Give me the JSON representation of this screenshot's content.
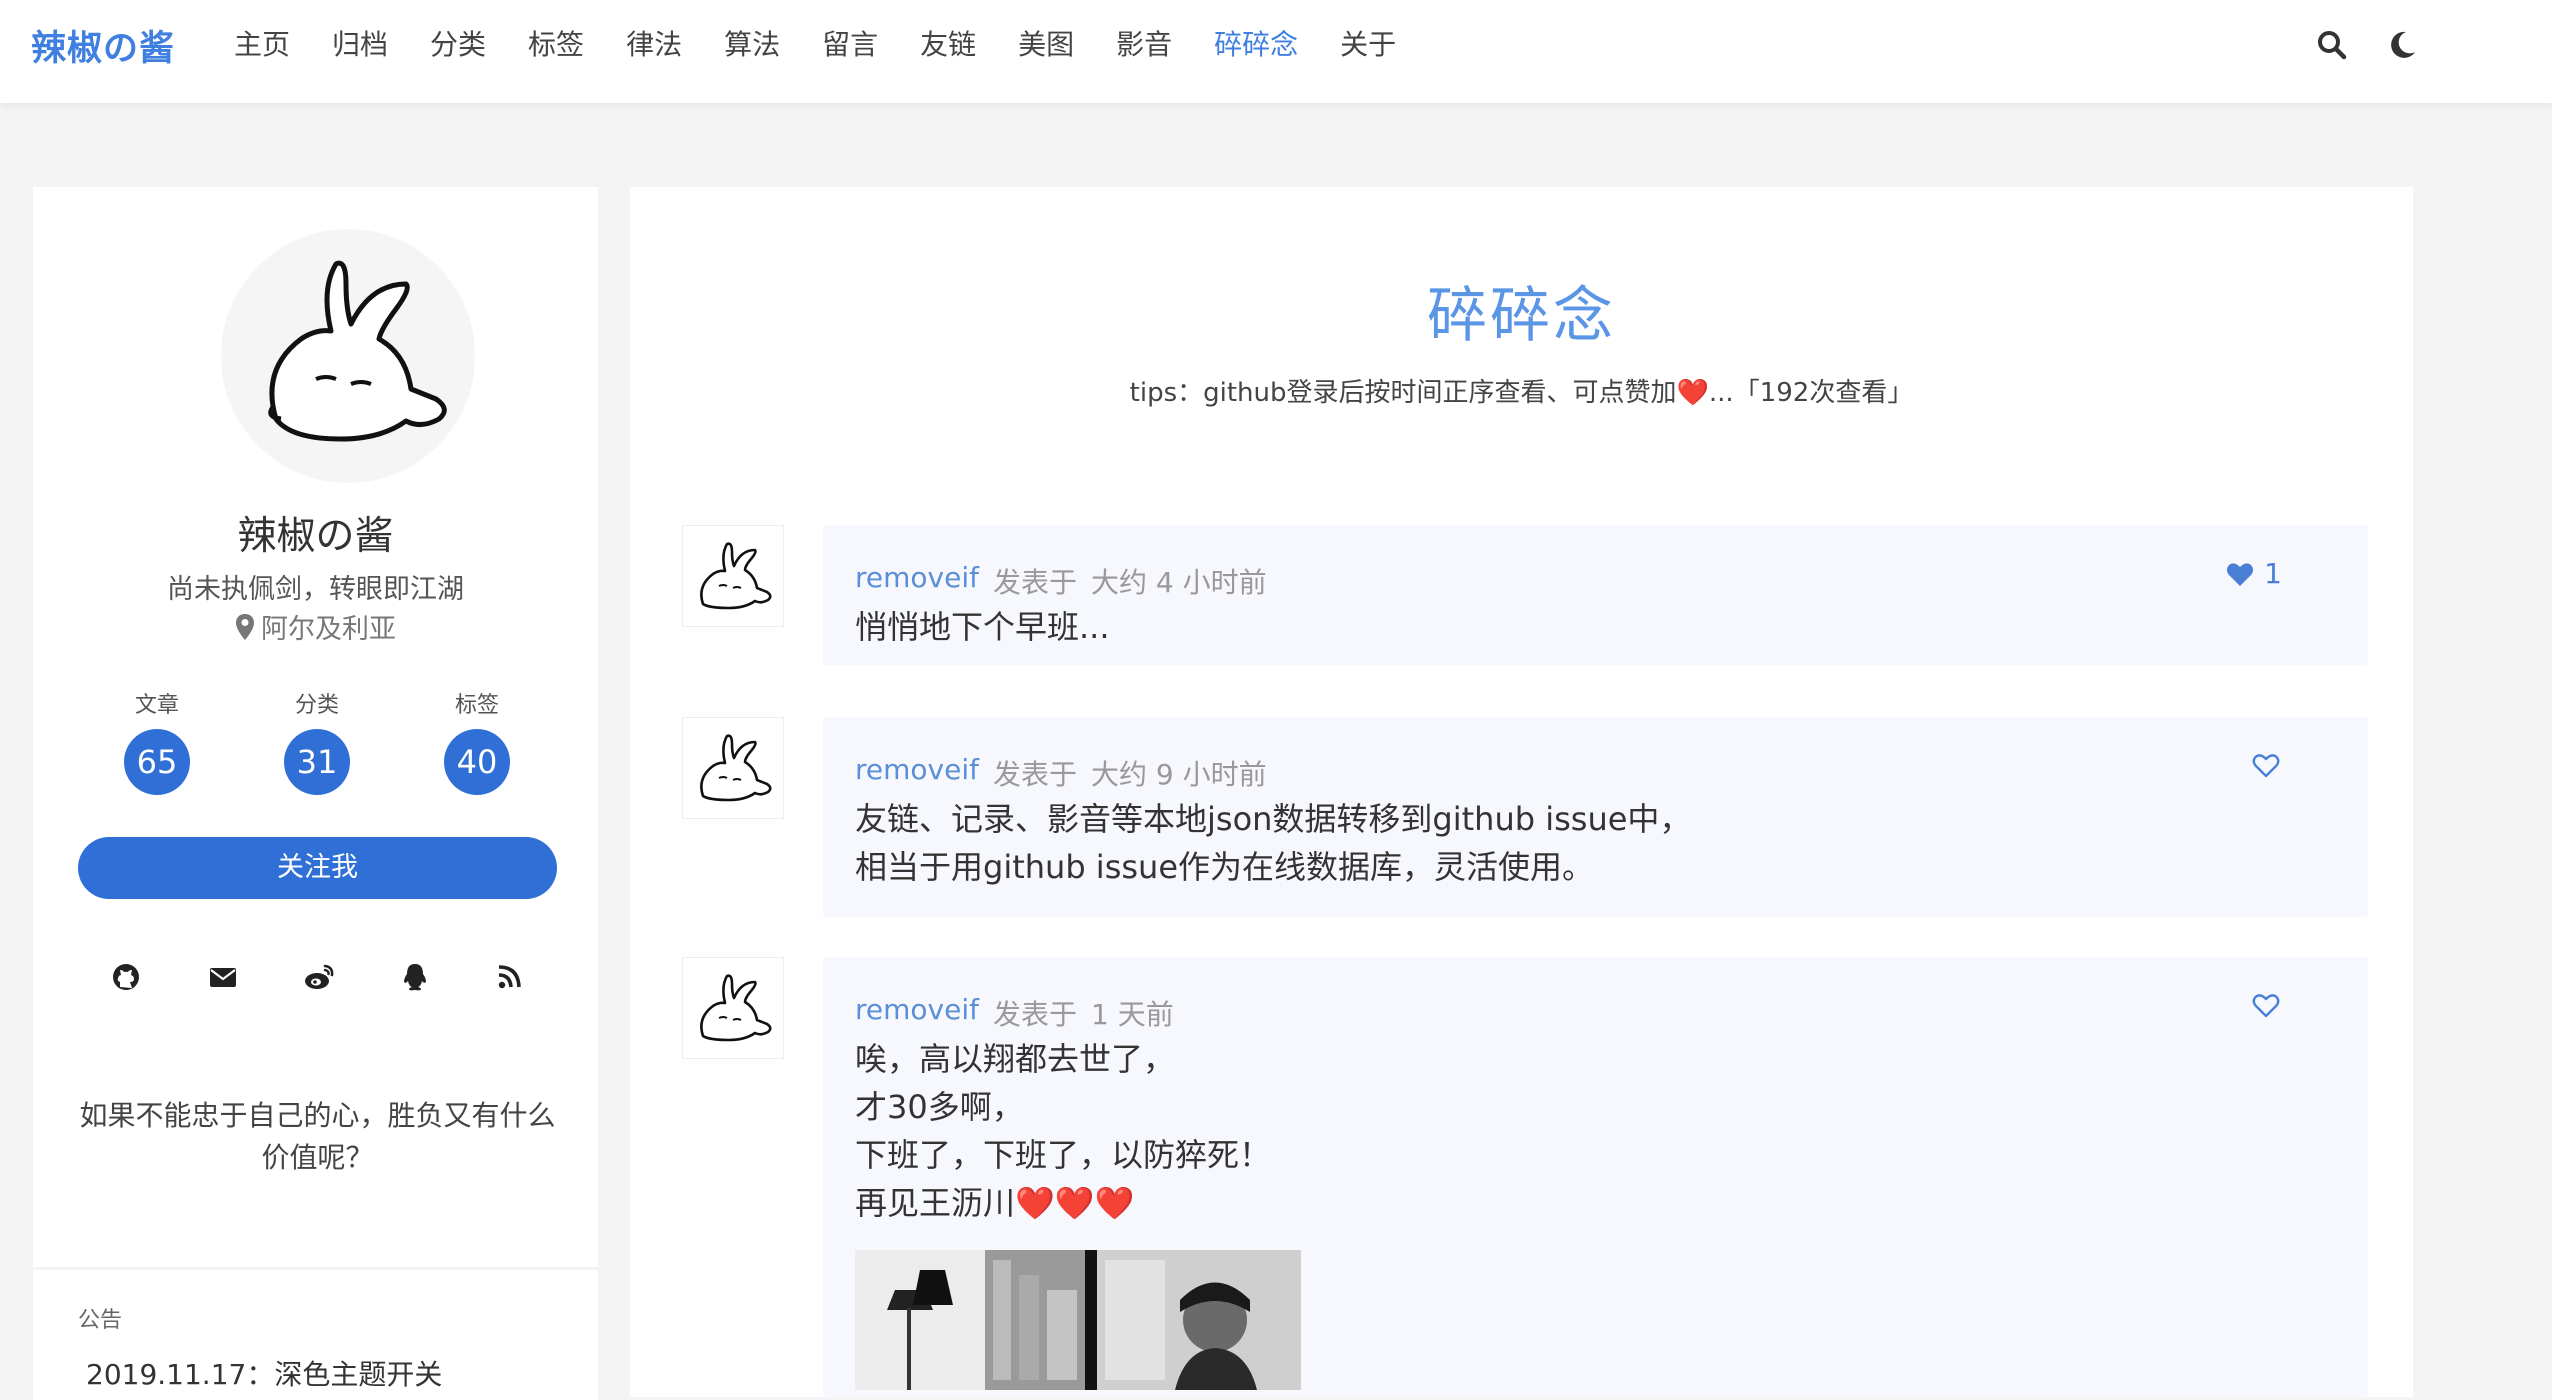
{
  "header": {
    "logo": "辣椒の酱",
    "nav": [
      "主页",
      "归档",
      "分类",
      "标签",
      "律法",
      "算法",
      "留言",
      "友链",
      "美图",
      "影音",
      "碎碎念",
      "关于"
    ],
    "active_nav": "碎碎念",
    "icons": [
      "search-icon",
      "moon-icon"
    ]
  },
  "sidebar": {
    "name": "辣椒の酱",
    "motto": "尚未执佩剑，转眼即江湖",
    "location": "阿尔及利亚",
    "stats": [
      {
        "label": "文章",
        "value": "65"
      },
      {
        "label": "分类",
        "value": "31"
      },
      {
        "label": "标签",
        "value": "40"
      }
    ],
    "follow_label": "关注我",
    "social_icons": [
      "github-icon",
      "mail-icon",
      "weibo-icon",
      "qq-icon",
      "rss-icon"
    ],
    "quote": "如果不能忠于自己的心，胜负又有什么价值呢？",
    "notice_title": "公告",
    "notice_text": "2019.11.17：深色主题开关"
  },
  "main": {
    "title": "碎碎念",
    "tips": "tips：github登录后按时间正序查看、可点赞加❤️...「192次查看」",
    "talks": [
      {
        "author": "removeif",
        "posted": "发表于",
        "time": "大约 4 小时前",
        "liked": true,
        "likes": "1",
        "lines": [
          "悄悄地下个早班..."
        ]
      },
      {
        "author": "removeif",
        "posted": "发表于",
        "time": "大约 9 小时前",
        "liked": false,
        "likes": "",
        "lines": [
          "友链、记录、影音等本地json数据转移到github issue中，",
          "相当于用github issue作为在线数据库，灵活使用。"
        ]
      },
      {
        "author": "removeif",
        "posted": "发表于",
        "time": "1 天前",
        "liked": false,
        "likes": "",
        "lines": [
          "唉，高以翔都去世了，",
          "才30多啊，",
          "下班了，下班了，以防猝死！",
          "再见王沥川❤️❤️❤️"
        ]
      }
    ]
  },
  "colors": {
    "accent": "#3f7fe0",
    "button": "#2f6fd6",
    "talk_bg": "#f6f8fd"
  }
}
